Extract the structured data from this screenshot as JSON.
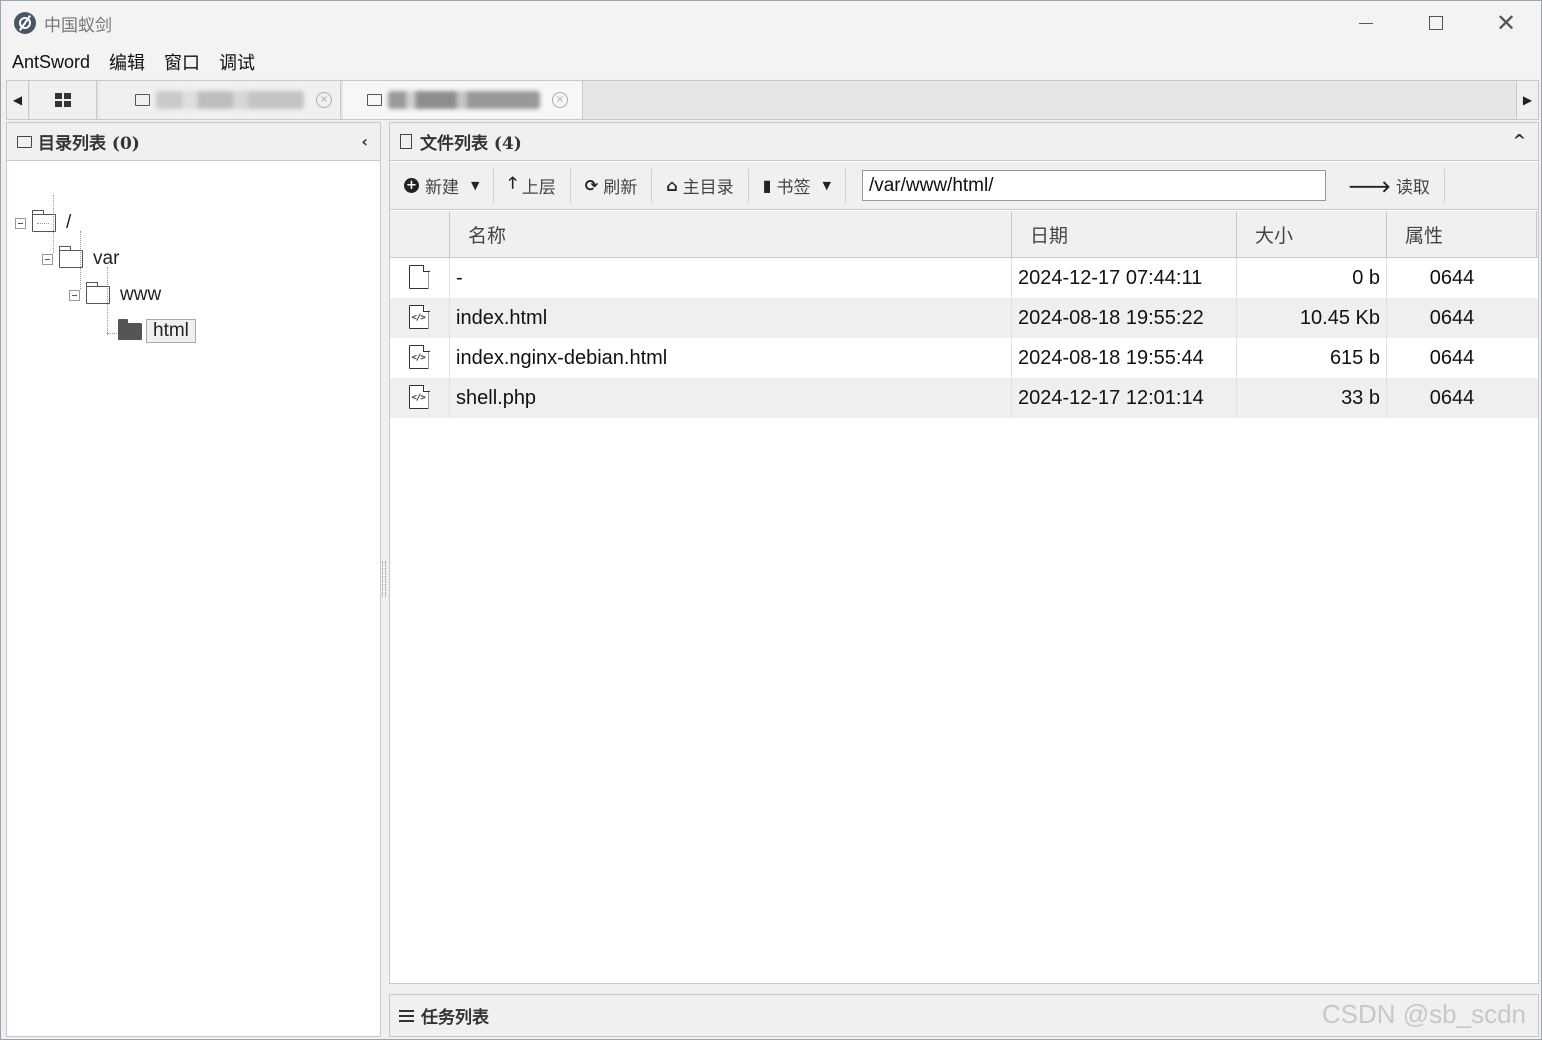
{
  "window": {
    "title": "中国蚁剑",
    "controls": {
      "minimize": "minimize",
      "maximize": "maximize",
      "close": "✕"
    }
  },
  "menu": [
    "AntSword",
    "编辑",
    "窗口",
    "调试"
  ],
  "tabs": {
    "scroll_left": "◀",
    "scroll_right": "▶",
    "home_icon": "grid-icon"
  },
  "dir_panel": {
    "title": "目录列表 (0)",
    "collapse": "‹",
    "tree": [
      {
        "label": "/",
        "level": 0
      },
      {
        "label": "var",
        "level": 1
      },
      {
        "label": "www",
        "level": 2
      },
      {
        "label": "html",
        "level": 3,
        "selected": true
      }
    ]
  },
  "file_panel": {
    "title": "文件列表 (4)",
    "collapse": "^",
    "toolbar": {
      "new_label": "新建",
      "up_label": "上层",
      "refresh_label": "刷新",
      "home_label": "主目录",
      "bookmark_label": "书签",
      "path_value": "/var/www/html/",
      "read_label": "读取"
    },
    "columns": {
      "name": "名称",
      "date": "日期",
      "size": "大小",
      "attr": "属性"
    },
    "rows": [
      {
        "icon": "file-icon",
        "name": "-",
        "date": "2024-12-17 07:44:11",
        "size": "0 b",
        "attr": "0644"
      },
      {
        "icon": "code-file-icon",
        "name": "index.html",
        "date": "2024-08-18 19:55:22",
        "size": "10.45 Kb",
        "attr": "0644"
      },
      {
        "icon": "code-file-icon",
        "name": "index.nginx-debian.html",
        "date": "2024-08-18 19:55:44",
        "size": "615 b",
        "attr": "0644"
      },
      {
        "icon": "code-file-icon",
        "name": "shell.php",
        "date": "2024-12-17 12:01:14",
        "size": "33 b",
        "attr": "0644"
      }
    ]
  },
  "task_panel": {
    "title": "任务列表",
    "watermark": "CSDN @sb_scdn"
  }
}
